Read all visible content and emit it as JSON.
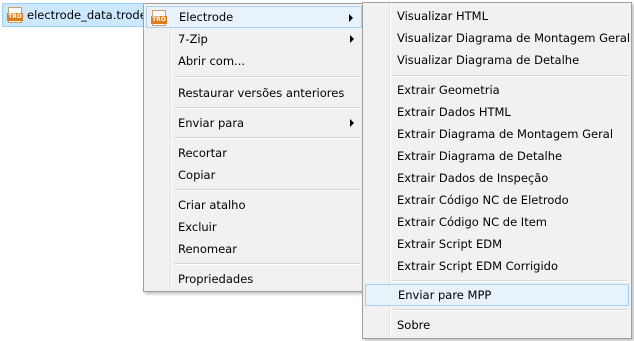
{
  "file": {
    "name": "electrode_data.trode",
    "icon": "trode-file-icon",
    "badge": "TRO"
  },
  "context_menu": {
    "items": [
      {
        "label": "Electrode",
        "submenu": true
      },
      {
        "label": "7-Zip",
        "submenu": true
      },
      {
        "label": "Abrir com..."
      },
      {
        "label": "Restaurar versões anteriores"
      },
      {
        "label": "Enviar para",
        "submenu": true
      },
      {
        "label": "Recortar"
      },
      {
        "label": "Copiar"
      },
      {
        "label": "Criar atalho"
      },
      {
        "label": "Excluir"
      },
      {
        "label": "Renomear"
      },
      {
        "label": "Propriedades"
      }
    ]
  },
  "electrode_submenu": {
    "items": [
      {
        "label": "Visualizar HTML"
      },
      {
        "label": "Visualizar Diagrama de Montagem Geral"
      },
      {
        "label": "Visualizar Diagrama de Detalhe"
      },
      {
        "label": "Extrair Geometria"
      },
      {
        "label": "Extrair Dados HTML"
      },
      {
        "label": "Extrair Diagrama de Montagem Geral"
      },
      {
        "label": "Extrair Diagrama de Detalhe"
      },
      {
        "label": "Extrair Dados de Inspeção"
      },
      {
        "label": "Extrair Código NC de Eletrodo"
      },
      {
        "label": "Extrair Código NC de Item"
      },
      {
        "label": "Extrair Script EDM"
      },
      {
        "label": "Extrair Script EDM Corrigido"
      },
      {
        "label": "Enviar pare MPP",
        "highlighted": true
      },
      {
        "label": "Sobre"
      }
    ]
  },
  "colors": {
    "selection": "#cce8ff",
    "menu_background": "#f1f1f1",
    "highlight": "#e8f2fb",
    "icon_accent": "#e07b1a"
  }
}
